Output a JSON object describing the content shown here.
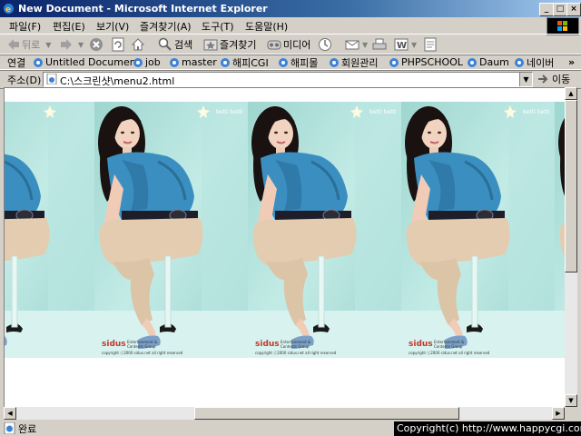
{
  "window": {
    "title": "New Document - Microsoft Internet Explorer"
  },
  "menu": [
    "파일(F)",
    "편집(E)",
    "보기(V)",
    "즐겨찾기(A)",
    "도구(T)",
    "도움말(H)"
  ],
  "toolbar": {
    "back": "뒤로",
    "search": "검색",
    "favorites": "즐겨찾기",
    "media": "미디어"
  },
  "links": {
    "label": "연결",
    "items": [
      "Untitled Document",
      "job",
      "master",
      "해피CGI",
      "해피몰",
      "회원관리",
      "PHPSCHOOL",
      "Daum",
      "네이버"
    ],
    "more": "»"
  },
  "address": {
    "label": "주소(D)",
    "value": "C:\\스크린샷\\menu2.html",
    "go": "이동"
  },
  "photo": {
    "brand": "sidus",
    "brand_sub": "Entertainment & Contents Group",
    "copyright": "copyright ⓒ2000 sidus.net all right reserved",
    "corner_text": "betti betti"
  },
  "status": {
    "text": "완료",
    "copyright": "Copyright(c) http://www.happycgi.com"
  },
  "colors": {
    "title_start": "#0a246a",
    "title_end": "#a6caf0",
    "photo_bg": "#aee0da",
    "blouse": "#3b8fc0",
    "pants": "#e3ccb0"
  }
}
